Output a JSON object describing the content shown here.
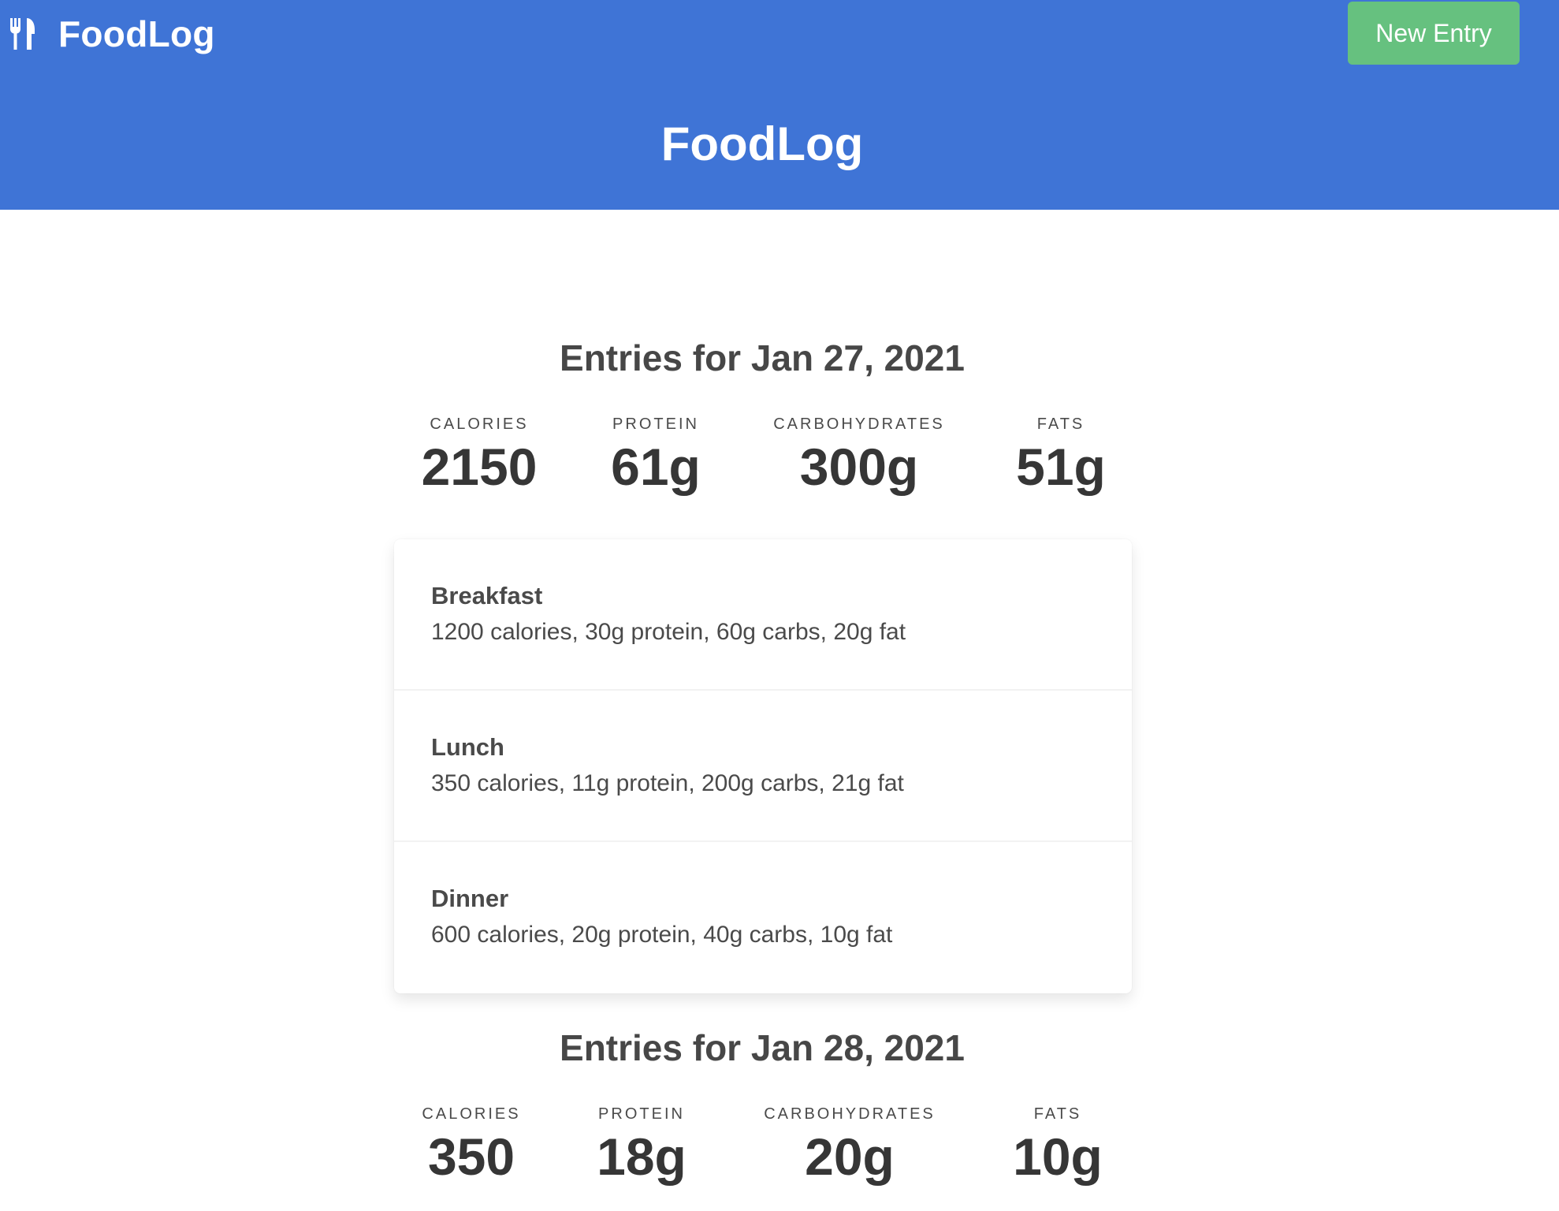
{
  "navbar": {
    "brand_icon": "utensils-icon",
    "brand_name": "FoodLog",
    "new_entry_label": "New Entry"
  },
  "hero": {
    "title": "FoodLog"
  },
  "colors": {
    "primary": "#3f74d6",
    "success": "#66c17f",
    "text": "#363636"
  },
  "days": [
    {
      "title": "Entries for Jan 27, 2021",
      "stats": [
        {
          "heading": "CALORIES",
          "value": "2150"
        },
        {
          "heading": "PROTEIN",
          "value": "61g"
        },
        {
          "heading": "CARBOHYDRATES",
          "value": "300g"
        },
        {
          "heading": "FATS",
          "value": "51g"
        }
      ],
      "entries": [
        {
          "name": "Breakfast",
          "detail": "1200 calories, 30g protein, 60g carbs, 20g fat"
        },
        {
          "name": "Lunch",
          "detail": "350 calories, 11g protein, 200g carbs, 21g fat"
        },
        {
          "name": "Dinner",
          "detail": "600 calories, 20g protein, 40g carbs, 10g fat"
        }
      ]
    },
    {
      "title": "Entries for Jan 28, 2021",
      "stats": [
        {
          "heading": "CALORIES",
          "value": "350"
        },
        {
          "heading": "PROTEIN",
          "value": "18g"
        },
        {
          "heading": "CARBOHYDRATES",
          "value": "20g"
        },
        {
          "heading": "FATS",
          "value": "10g"
        }
      ]
    }
  ]
}
